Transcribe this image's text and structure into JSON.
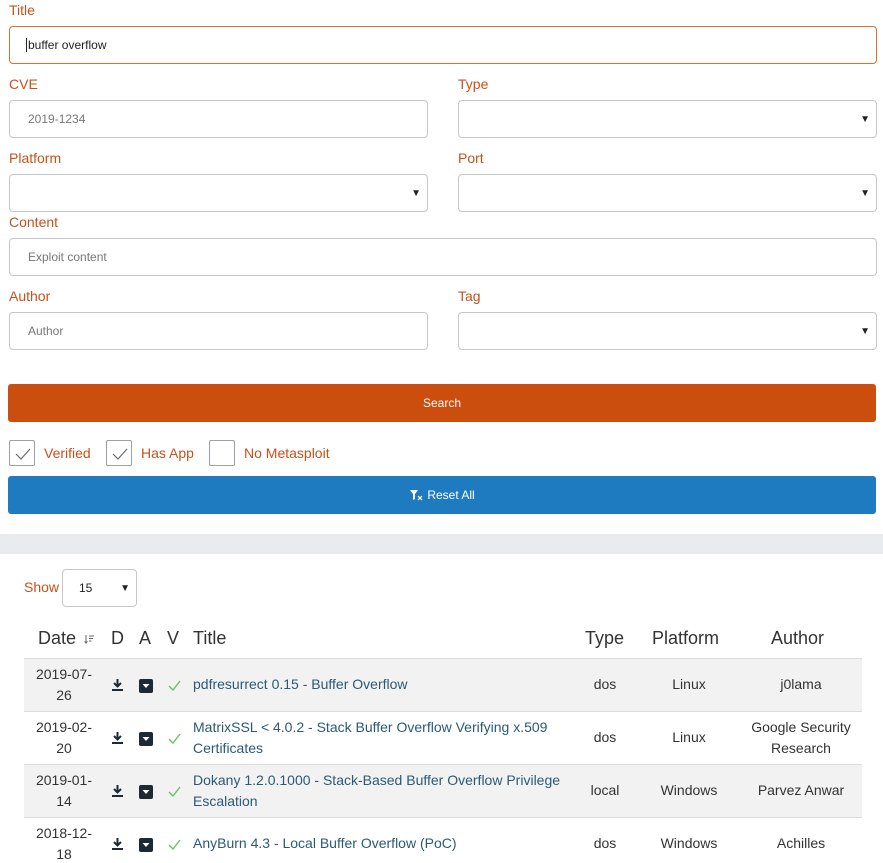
{
  "form": {
    "title_label": "Title",
    "title_value": "buffer overflow",
    "cve_label": "CVE",
    "cve_placeholder": "2019-1234",
    "type_label": "Type",
    "platform_label": "Platform",
    "port_label": "Port",
    "content_label": "Content",
    "content_placeholder": "Exploit content",
    "author_label": "Author",
    "author_placeholder": "Author",
    "tag_label": "Tag",
    "search_label": "Search",
    "verified_label": "Verified",
    "verified_checked": true,
    "has_app_label": "Has App",
    "has_app_checked": true,
    "no_metasploit_label": "No Metasploit",
    "no_metasploit_checked": false,
    "reset_label": "Reset All"
  },
  "table": {
    "show_label": "Show",
    "show_value": "15",
    "headers": {
      "date": "Date",
      "d": "D",
      "a": "A",
      "v": "V",
      "title": "Title",
      "type": "Type",
      "platform": "Platform",
      "author": "Author"
    },
    "rows": [
      {
        "date_line1": "2019-07-",
        "date_line2": "26",
        "title_line1": "pdfresurrect 0.15 - Buffer Overflow",
        "title_line2": "",
        "type": "dos",
        "platform": "Linux",
        "author_line1": "j0lama",
        "author_line2": ""
      },
      {
        "date_line1": "2019-02-",
        "date_line2": "20",
        "title_line1": "MatrixSSL < 4.0.2 - Stack Buffer Overflow Verifying x.509",
        "title_line2": "Certificates",
        "type": "dos",
        "platform": "Linux",
        "author_line1": "Google Security",
        "author_line2": "Research"
      },
      {
        "date_line1": "2019-01-",
        "date_line2": "14",
        "title_line1": "Dokany 1.2.0.1000 - Stack-Based Buffer Overflow Privilege",
        "title_line2": "Escalation",
        "type": "local",
        "platform": "Windows",
        "author_line1": "Parvez Anwar",
        "author_line2": ""
      },
      {
        "date_line1": "2018-12-",
        "date_line2": "18",
        "title_line1": "AnyBurn 4.3 - Local Buffer Overflow (PoC)",
        "title_line2": "",
        "type": "dos",
        "platform": "Windows",
        "author_line1": "Achilles",
        "author_line2": ""
      }
    ]
  },
  "colors": {
    "accent_orange": "#cc4e0f",
    "accent_blue": "#1f7bbf",
    "link": "#2a5a78",
    "check_green": "#6abf69"
  }
}
